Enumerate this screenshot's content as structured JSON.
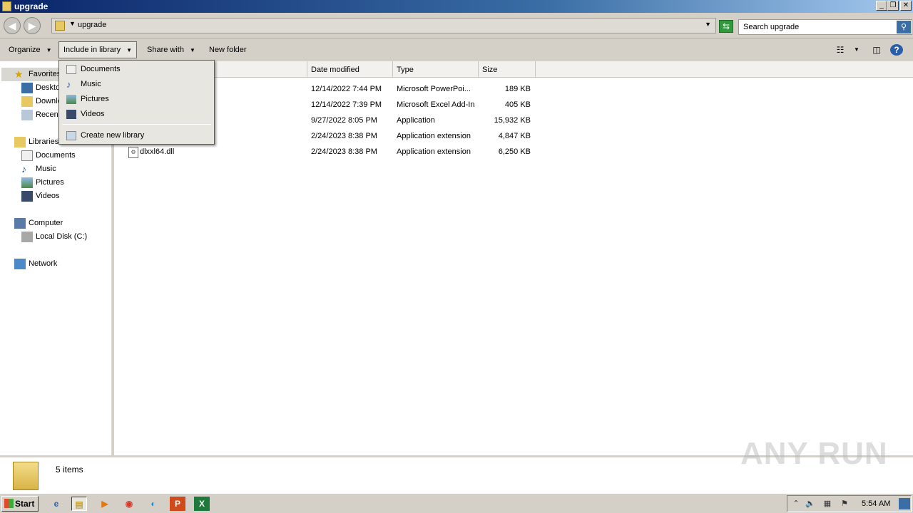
{
  "window": {
    "title": "upgrade"
  },
  "address": {
    "path": "upgrade",
    "search_placeholder": "Search upgrade"
  },
  "toolbar": {
    "organize": "Organize",
    "include_in_library": "Include in library",
    "share_with": "Share with",
    "new_folder": "New folder"
  },
  "sidebar": {
    "favorites": {
      "label": "Favorites",
      "items": [
        "Desktop",
        "Downloads",
        "Recent Places"
      ]
    },
    "libraries": {
      "label": "Libraries",
      "items": [
        "Documents",
        "Music",
        "Pictures",
        "Videos"
      ]
    },
    "computer": {
      "label": "Computer",
      "items": [
        "Local Disk (C:)"
      ]
    },
    "network": {
      "label": "Network"
    }
  },
  "columns": {
    "name": "Name",
    "date": "Date modified",
    "type": "Type",
    "size": "Size"
  },
  "files": [
    {
      "name": "",
      "date": "12/14/2022 7:44 PM",
      "type": "Microsoft PowerPoi...",
      "size": "189 KB"
    },
    {
      "name": "",
      "date": "12/14/2022 7:39 PM",
      "type": "Microsoft Excel Add-In",
      "size": "405 KB"
    },
    {
      "name": "",
      "date": "9/27/2022 8:05 PM",
      "type": "Application",
      "size": "15,932 KB"
    },
    {
      "name": "",
      "date": "2/24/2023 8:38 PM",
      "type": "Application extension",
      "size": "4,847 KB"
    },
    {
      "name": "dlxxl64.dll",
      "date": "2/24/2023 8:38 PM",
      "type": "Application extension",
      "size": "6,250 KB"
    }
  ],
  "library_menu": {
    "items": [
      "Documents",
      "Music",
      "Pictures",
      "Videos"
    ],
    "create_new": "Create new library"
  },
  "status": {
    "item_count": "5 items"
  },
  "watermark": "ANY RUN",
  "taskbar": {
    "start": "Start",
    "clock": "5:54 AM"
  }
}
